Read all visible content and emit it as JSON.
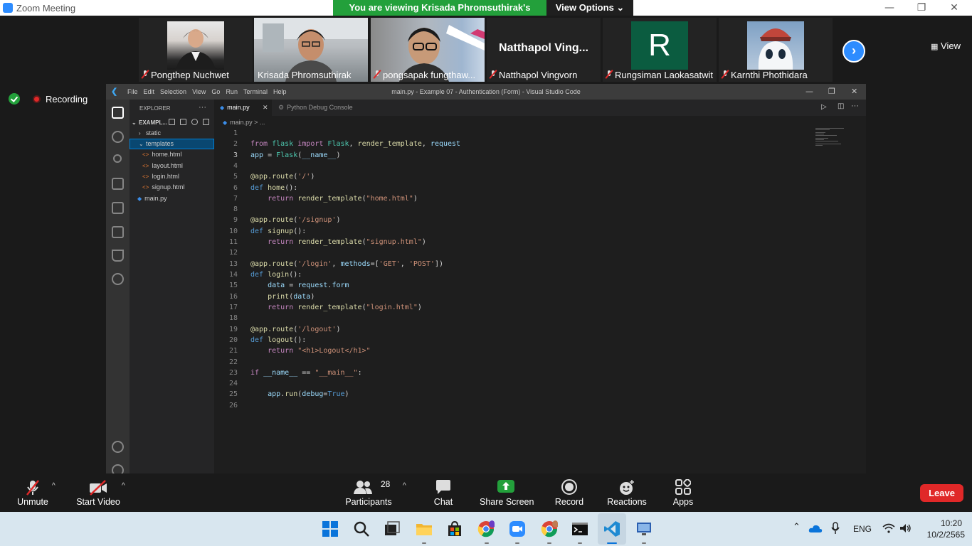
{
  "zoom": {
    "window_title": "Zoom Meeting",
    "viewing_banner": "You are viewing Krisada Phromsuthirak's screen",
    "view_options": "View Options ⌄",
    "view_button": "View",
    "recording_label": "Recording"
  },
  "participants": [
    {
      "name": "Pongthep Nuchwet"
    },
    {
      "name": "Krisada Phromsuthirak"
    },
    {
      "name": "pongsapak fungthaw..."
    },
    {
      "name": "Natthapol Vingvorn",
      "tile_label": "Natthapol  Ving..."
    },
    {
      "name": "Rungsiman Laokasatwit",
      "avatar_letter": "R"
    },
    {
      "name": "Karnthi Phothidara"
    }
  ],
  "vscode": {
    "menu": [
      "File",
      "Edit",
      "Selection",
      "View",
      "Go",
      "Run",
      "Terminal",
      "Help"
    ],
    "window_title": "main.py - Example 07 - Authentication (Form) - Visual Studio Code",
    "explorer_title": "EXPLORER",
    "explorer_more": "···",
    "project_root": "EXAMPL...",
    "tree": {
      "static": "static",
      "templates": "templates",
      "home": "home.html",
      "layout": "layout.html",
      "login": "login.html",
      "signup": "signup.html",
      "main": "main.py"
    },
    "tabs": {
      "main": "main.py",
      "debug": "Python Debug Console"
    },
    "breadcrumb": "main.py > ...",
    "line_numbers": [
      "1",
      "2",
      "3",
      "4",
      "5",
      "6",
      "7",
      "8",
      "9",
      "10",
      "11",
      "12",
      "13",
      "14",
      "15",
      "16",
      "17",
      "18",
      "19",
      "20",
      "21",
      "22",
      "23",
      "24",
      "25",
      "26"
    ]
  },
  "toolbar": {
    "unmute": "Unmute",
    "start_video": "Start Video",
    "participants": "Participants",
    "participants_count": "28",
    "chat": "Chat",
    "share_screen": "Share Screen",
    "record": "Record",
    "reactions": "Reactions",
    "apps": "Apps",
    "leave": "Leave"
  },
  "taskbar": {
    "language": "ENG",
    "time": "10:20",
    "date": "10/2/2565"
  },
  "colors": {
    "banner_green": "#23a03b",
    "zoom_blue": "#2d8cff",
    "leave_red": "#e02828",
    "vscode_selection": "#094771"
  }
}
